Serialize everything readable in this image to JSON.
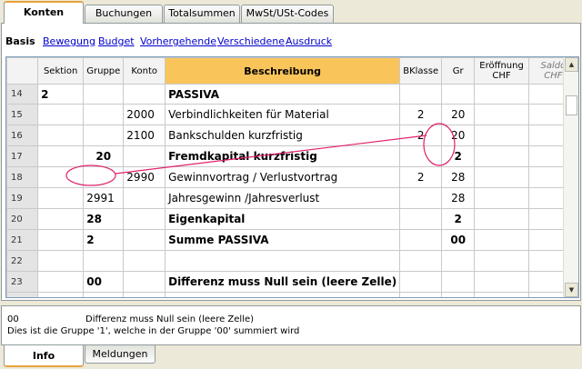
{
  "top_tabs": [
    "Konten",
    "Buchungen",
    "Totalsummen",
    "MwSt/USt-Codes"
  ],
  "subnav": {
    "active": "Basis",
    "links": [
      "Bewegung",
      "Budget",
      "Vorhergehende",
      "Verschiedene",
      "Ausdruck"
    ]
  },
  "table": {
    "headers": {
      "sektion": "Sektion",
      "gruppe": "Gruppe",
      "konto": "Konto",
      "beschreibung": "Beschreibung",
      "bklasse": "BKlasse",
      "gr": "Gr",
      "eroeffnung": "Eröffnung",
      "eroeffnung_unit": "CHF",
      "saldo": "Saldo",
      "saldo_unit": "CHF"
    },
    "rows": [
      {
        "num": "14",
        "sektion": "2",
        "gruppe": "",
        "konto": "",
        "beschreibung": "PASSIVA",
        "bklasse": "",
        "gr": ""
      },
      {
        "num": "15",
        "sektion": "",
        "gruppe": "",
        "konto": "2000",
        "beschreibung": "Verbindlichkeiten für Material",
        "bklasse": "2",
        "gr": "20"
      },
      {
        "num": "16",
        "sektion": "",
        "gruppe": "",
        "konto": "2100",
        "beschreibung": "Bankschulden kurzfristig",
        "bklasse": "2",
        "gr": "20"
      },
      {
        "num": "17",
        "sektion": "",
        "gruppe": "20",
        "konto": "",
        "beschreibung": "Fremdkapital kurzfristig",
        "bklasse": "",
        "gr": "2"
      },
      {
        "num": "18",
        "sektion": "",
        "gruppe": "",
        "konto": "2990",
        "beschreibung": "Gewinnvortrag / Verlustvortrag",
        "bklasse": "2",
        "gr": "28"
      },
      {
        "num": "19",
        "sektion": "",
        "gruppe": "2991",
        "konto": "",
        "beschreibung": "Jahresgewinn /Jahresverlust",
        "bklasse": "",
        "gr": "28"
      },
      {
        "num": "20",
        "sektion": "",
        "gruppe": "28",
        "konto": "",
        "beschreibung": "Eigenkapital",
        "bklasse": "",
        "gr": "2"
      },
      {
        "num": "21",
        "sektion": "",
        "gruppe": "2",
        "konto": "",
        "beschreibung": "Summe PASSIVA",
        "bklasse": "",
        "gr": "00"
      },
      {
        "num": "22",
        "sektion": "",
        "gruppe": "",
        "konto": "",
        "beschreibung": "",
        "bklasse": "",
        "gr": ""
      },
      {
        "num": "23",
        "sektion": "",
        "gruppe": "00",
        "konto": "",
        "beschreibung": "Differenz muss Null sein (leere Zelle)",
        "bklasse": "",
        "gr": ""
      },
      {
        "num": "24",
        "sektion": "",
        "gruppe": "",
        "konto": "",
        "beschreibung": "",
        "bklasse": "",
        "gr": ""
      }
    ]
  },
  "info": {
    "code": "00",
    "description": "Differenz muss Null sein (leere Zelle)",
    "note": "Dies ist die Gruppe '1', welche in der Gruppe '00' summiert wird"
  },
  "bottom_tabs": [
    "Info",
    "Meldungen"
  ],
  "colors": {
    "accent": "#e8a33c",
    "header_highlight": "#f9c55b",
    "link": "#0000cc",
    "annotation": "#e0206a"
  },
  "icons": [
    "scroll-up-icon",
    "scroll-down-icon"
  ]
}
